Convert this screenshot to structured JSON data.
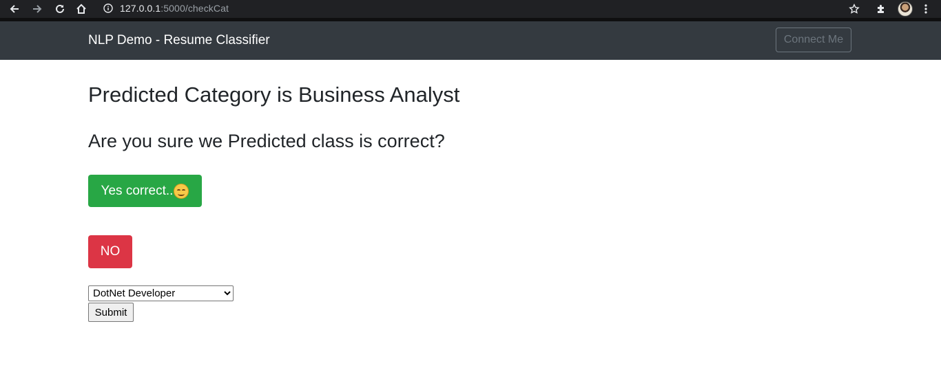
{
  "browser": {
    "url_host": "127.0.0.1",
    "url_path": ":5000/checkCat",
    "icons": [
      "back-icon",
      "forward-icon",
      "reload-icon",
      "home-icon",
      "info-icon",
      "star-icon",
      "extensions-icon",
      "avatar",
      "menu-icon"
    ]
  },
  "navbar": {
    "brand": "NLP Demo - Resume Classifier",
    "connect_label": "Connect Me"
  },
  "main": {
    "heading": "Predicted Category is Business Analyst",
    "question": "Are you sure we Predicted class is correct?",
    "yes_label": "Yes correct..",
    "no_label": "NO",
    "select_value": "DotNet Developer",
    "submit_label": "Submit"
  },
  "colors": {
    "navbar_bg": "#343a40",
    "success": "#28a745",
    "danger": "#dc3545",
    "chrome_bg": "#202124"
  }
}
